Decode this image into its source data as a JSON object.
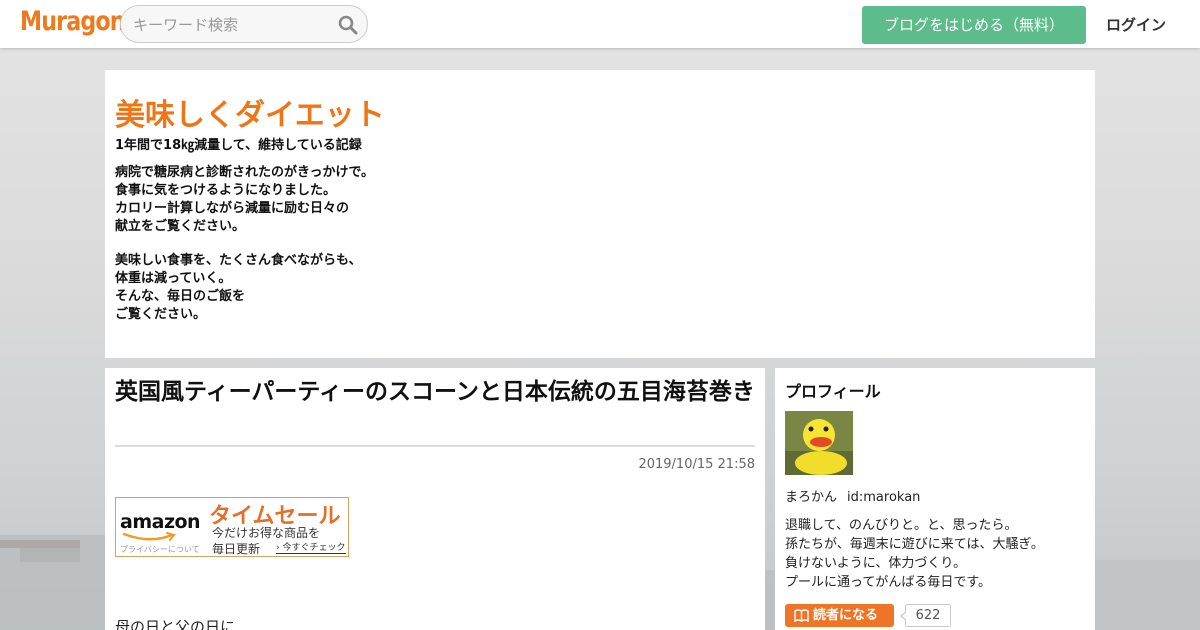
{
  "brand": {
    "logo_text": "Muragon",
    "accent_color": "#ee7a1c",
    "start_button_color": "#5dbc8b"
  },
  "topbar": {
    "search_placeholder": "キーワード検索",
    "search_value": "",
    "search_icon": "search-icon",
    "start_button_label": "ブログをはじめる（無料）",
    "login_label": "ログイン"
  },
  "blog": {
    "title": "美味しくダイエット",
    "subtitle": "1年間で18㎏減量して、維持している記録",
    "description_block_1": [
      "病院で糖尿病と診断されたのがきっかけで。",
      "食事に気をつけるようになりました。",
      "カロリー計算しながら減量に励む日々の",
      "献立をご覧ください。"
    ],
    "description_block_2": [
      "美味しい食事を、たくさん食べながらも、",
      "体重は減っていく。",
      "そんな、毎日のご飯を",
      "ご覧ください。"
    ]
  },
  "post": {
    "title": "英国風ティーパーティーのスコーンと日本伝統の五目海苔巻き",
    "date": "2019/10/15 21:58",
    "body_first_line": "母の日と父の日に"
  },
  "ad": {
    "brand": "amazon",
    "privacy_link": "プライバシーについて",
    "headline": "タイムセール",
    "line1": "今だけお得な商品を",
    "line2": "毎日更新",
    "cta": "今すぐチェック"
  },
  "sidebar": {
    "profile_heading": "プロフィール",
    "profile_name": "まろかん",
    "profile_id": "id:marokan",
    "bio_lines": [
      "退職して、のんびりと。と、思ったら。",
      "孫たちが、毎週末に遊びに来ては、大騒ぎ。",
      "負けないように、体力づくり。",
      "プールに通ってがんばる毎日です。"
    ],
    "follow_button_label": "読者になる",
    "follow_button_color": "#f07426",
    "follower_count": "622"
  }
}
